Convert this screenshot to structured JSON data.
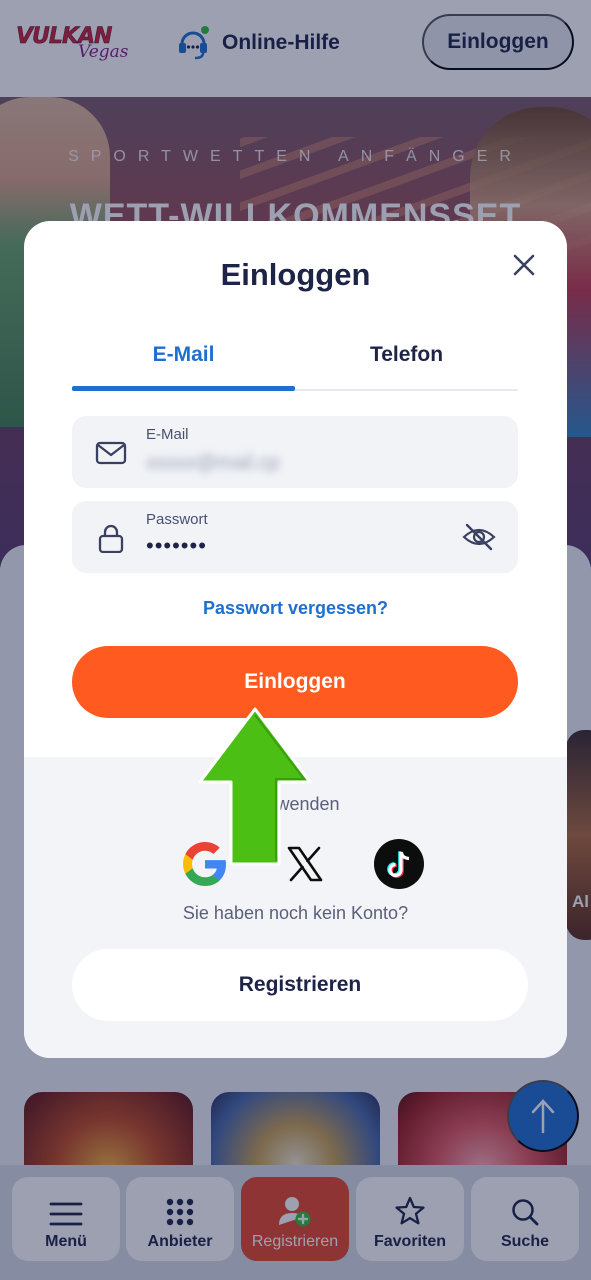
{
  "header": {
    "logo_main": "VULKAN",
    "logo_sub": "Vegas",
    "help_label": "Online-Hilfe",
    "login_label": "Einloggen"
  },
  "hero": {
    "subtitle": "SPORTWETTEN ANFÄNGER",
    "title": "WETT-WILLKOMMENSSET"
  },
  "side_tile_label": "Al",
  "modal": {
    "title": "Einloggen",
    "tabs": [
      {
        "label": "E-Mail",
        "active": true
      },
      {
        "label": "Telefon",
        "active": false
      }
    ],
    "email_field": {
      "label": "E-Mail",
      "value": "xxxxx@mail.cp"
    },
    "password_field": {
      "label": "Passwort",
      "value": "•••••••"
    },
    "forgot_password": "Passwort vergessen?",
    "login_button": "Einloggen",
    "social_hint": "verwenden",
    "social": [
      "google-icon",
      "x-icon",
      "tiktok-icon"
    ],
    "no_account": "Sie haben noch kein Konto?",
    "register_button": "Registrieren"
  },
  "bottom_nav": [
    {
      "label": "Menü",
      "icon": "hamburger-icon"
    },
    {
      "label": "Anbieter",
      "icon": "grid-icon"
    },
    {
      "label": "Registrieren",
      "icon": "add-user-icon",
      "active": true
    },
    {
      "label": "Favoriten",
      "icon": "star-icon"
    },
    {
      "label": "Suche",
      "icon": "search-icon"
    }
  ],
  "colors": {
    "accent_blue": "#1f6fcf",
    "login_orange": "#ff5a1f",
    "nav_active": "#e8462a",
    "arrow_green": "#4cbf14"
  }
}
